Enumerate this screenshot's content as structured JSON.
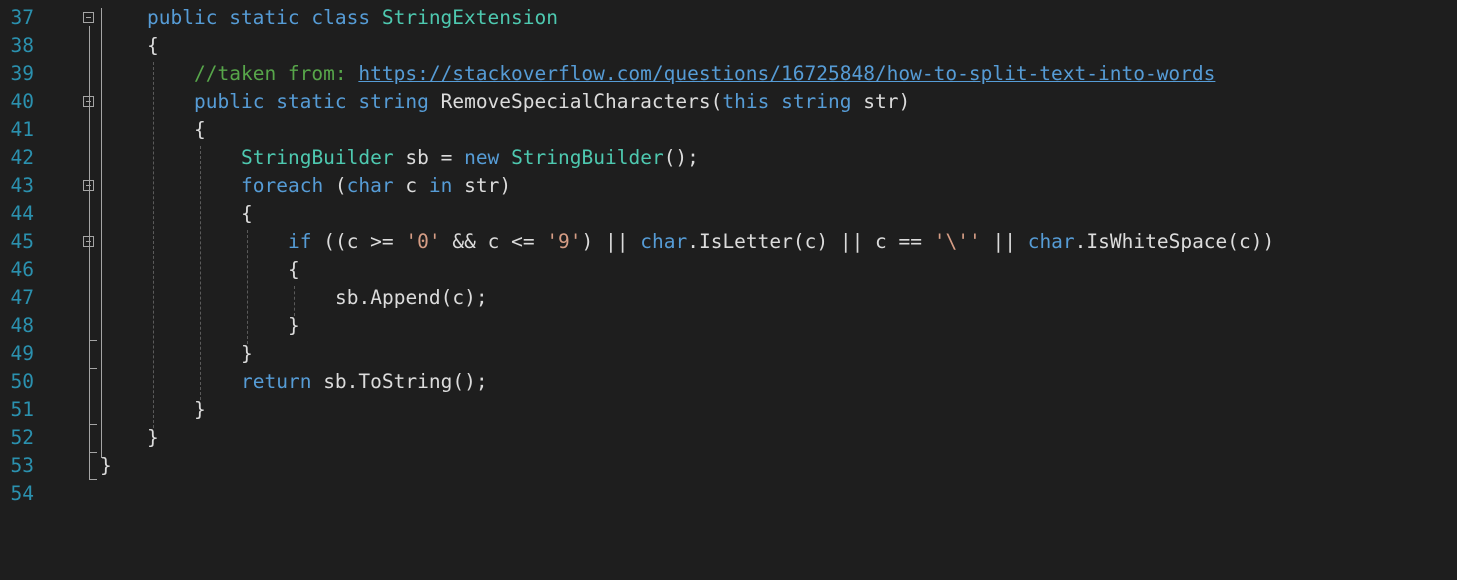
{
  "editor": {
    "lines": [
      {
        "num": "37",
        "indent": 1,
        "fold": true,
        "tokens": [
          {
            "t": "public",
            "c": "kw"
          },
          {
            "t": " ",
            "c": "pl"
          },
          {
            "t": "static",
            "c": "kw"
          },
          {
            "t": " ",
            "c": "pl"
          },
          {
            "t": "class",
            "c": "kw"
          },
          {
            "t": " ",
            "c": "pl"
          },
          {
            "t": "StringExtension",
            "c": "cls"
          }
        ]
      },
      {
        "num": "38",
        "indent": 1,
        "tokens": [
          {
            "t": "{",
            "c": "pl"
          }
        ]
      },
      {
        "num": "39",
        "indent": 2,
        "tokens": [
          {
            "t": "//taken from: ",
            "c": "cm"
          },
          {
            "t": "https://stackoverflow.com/questions/16725848/how-to-split-text-into-words",
            "c": "url"
          }
        ]
      },
      {
        "num": "40",
        "indent": 2,
        "fold": true,
        "tokens": [
          {
            "t": "public",
            "c": "kw"
          },
          {
            "t": " ",
            "c": "pl"
          },
          {
            "t": "static",
            "c": "kw"
          },
          {
            "t": " ",
            "c": "pl"
          },
          {
            "t": "string",
            "c": "kw"
          },
          {
            "t": " RemoveSpecialCharacters(",
            "c": "pl"
          },
          {
            "t": "this",
            "c": "kw"
          },
          {
            "t": " ",
            "c": "pl"
          },
          {
            "t": "string",
            "c": "kw"
          },
          {
            "t": " str)",
            "c": "pl"
          }
        ]
      },
      {
        "num": "41",
        "indent": 2,
        "tokens": [
          {
            "t": "{",
            "c": "pl"
          }
        ]
      },
      {
        "num": "42",
        "indent": 3,
        "tokens": [
          {
            "t": "StringBuilder",
            "c": "cls"
          },
          {
            "t": " sb = ",
            "c": "pl"
          },
          {
            "t": "new",
            "c": "kw"
          },
          {
            "t": " ",
            "c": "pl"
          },
          {
            "t": "StringBuilder",
            "c": "cls"
          },
          {
            "t": "();",
            "c": "pl"
          }
        ]
      },
      {
        "num": "43",
        "indent": 3,
        "fold": true,
        "tokens": [
          {
            "t": "foreach",
            "c": "kw"
          },
          {
            "t": " (",
            "c": "pl"
          },
          {
            "t": "char",
            "c": "kw"
          },
          {
            "t": " c ",
            "c": "pl"
          },
          {
            "t": "in",
            "c": "kw"
          },
          {
            "t": " str)",
            "c": "pl"
          }
        ]
      },
      {
        "num": "44",
        "indent": 3,
        "tokens": [
          {
            "t": "{",
            "c": "pl"
          }
        ]
      },
      {
        "num": "45",
        "indent": 4,
        "fold": true,
        "tokens": [
          {
            "t": "if",
            "c": "kw"
          },
          {
            "t": " ((c >= ",
            "c": "pl"
          },
          {
            "t": "'0'",
            "c": "str"
          },
          {
            "t": " && c <= ",
            "c": "pl"
          },
          {
            "t": "'9'",
            "c": "str"
          },
          {
            "t": ") || ",
            "c": "pl"
          },
          {
            "t": "char",
            "c": "kw"
          },
          {
            "t": ".IsLetter(c) || c == ",
            "c": "pl"
          },
          {
            "t": "'\\''",
            "c": "str"
          },
          {
            "t": " || ",
            "c": "pl"
          },
          {
            "t": "char",
            "c": "kw"
          },
          {
            "t": ".IsWhiteSpace(c))",
            "c": "pl"
          }
        ]
      },
      {
        "num": "46",
        "indent": 4,
        "tokens": [
          {
            "t": "{",
            "c": "pl"
          }
        ]
      },
      {
        "num": "47",
        "indent": 5,
        "tokens": [
          {
            "t": "sb.Append(c);",
            "c": "pl"
          }
        ]
      },
      {
        "num": "48",
        "indent": 4,
        "tokens": [
          {
            "t": "}",
            "c": "pl"
          }
        ]
      },
      {
        "num": "49",
        "indent": 3,
        "tokens": [
          {
            "t": "}",
            "c": "pl"
          }
        ]
      },
      {
        "num": "50",
        "indent": 3,
        "tokens": [
          {
            "t": "return",
            "c": "kw"
          },
          {
            "t": " sb.ToString();",
            "c": "pl"
          }
        ]
      },
      {
        "num": "51",
        "indent": 2,
        "tokens": [
          {
            "t": "}",
            "c": "pl"
          }
        ]
      },
      {
        "num": "52",
        "indent": 1,
        "tokens": [
          {
            "t": "}",
            "c": "pl"
          }
        ]
      },
      {
        "num": "53",
        "indent": 0,
        "tokens": [
          {
            "t": "}",
            "c": "pl"
          }
        ]
      },
      {
        "num": "54",
        "indent": 0,
        "tokens": []
      }
    ],
    "colors": {
      "background": "#1e1e1e",
      "line_number": "#2b91af",
      "keyword": "#569cd6",
      "type": "#4ec9b0",
      "comment": "#57a64a",
      "string": "#d69d85",
      "plain": "#dcdcdc"
    }
  }
}
